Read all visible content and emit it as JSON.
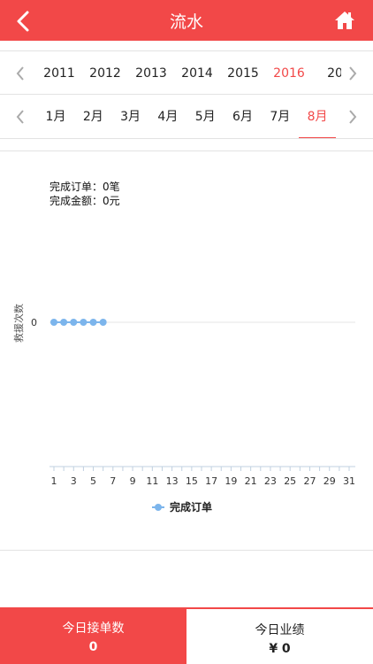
{
  "header": {
    "title": "流水",
    "back_icon": "back-chevron-icon",
    "home_icon": "home-icon"
  },
  "years": {
    "items": [
      "2011",
      "2012",
      "2013",
      "2014",
      "2015",
      "2016",
      "20"
    ],
    "selected": "2016"
  },
  "months": {
    "items": [
      "1月",
      "2月",
      "3月",
      "4月",
      "5月",
      "6月",
      "7月",
      "8月"
    ],
    "selected": "8月"
  },
  "summary": {
    "orders_line": "完成订单：0笔",
    "amount_line": "完成金额：0元"
  },
  "chart_data": {
    "type": "line",
    "ylabel": "救援次数",
    "yticks": [
      "0"
    ],
    "x_ticks": [
      "1",
      "3",
      "5",
      "7",
      "9",
      "11",
      "13",
      "15",
      "17",
      "19",
      "21",
      "23",
      "25",
      "27",
      "29",
      "31"
    ],
    "xlim": [
      1,
      31
    ],
    "series": [
      {
        "name": "完成订单",
        "x": [
          1,
          2,
          3,
          4,
          5,
          6
        ],
        "values": [
          0,
          0,
          0,
          0,
          0,
          0
        ],
        "color": "#7cb5ec"
      }
    ],
    "legend": "bottom"
  },
  "footer": {
    "left": {
      "label": "今日接单数",
      "value": "0"
    },
    "right": {
      "label": "今日业绩",
      "value": "¥ 0"
    }
  },
  "colors": {
    "accent": "#f24848",
    "series": "#7cb5ec"
  }
}
